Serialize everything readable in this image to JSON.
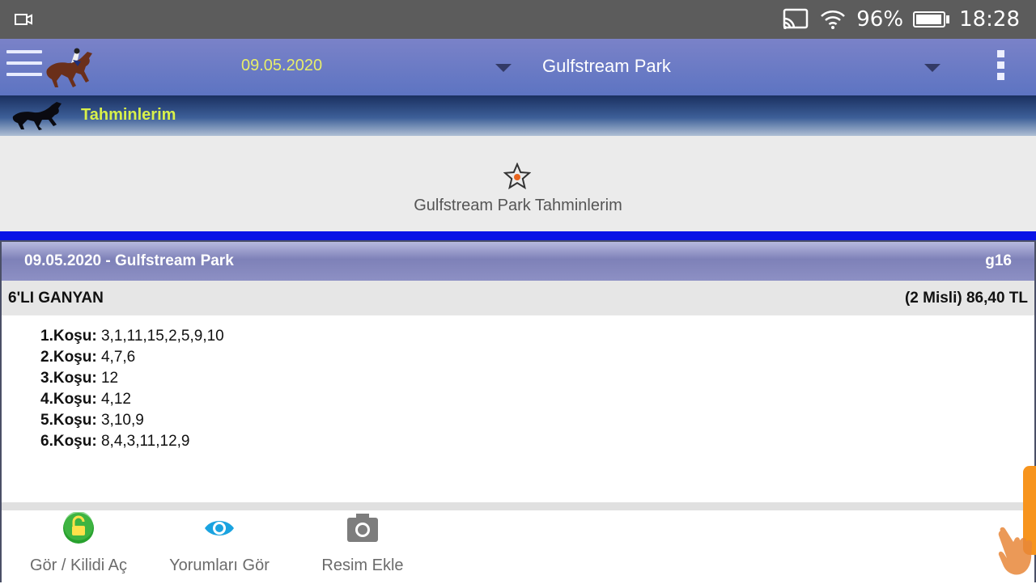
{
  "status_bar": {
    "battery_percent": "96%",
    "time": "18:28",
    "battery_level": 0.96,
    "icons": [
      "video-camera-icon",
      "cast-icon",
      "wifi-icon",
      "battery-icon"
    ]
  },
  "app_bar": {
    "date": "09.05.2020",
    "track": "Gulfstream Park",
    "icons": [
      "menu-icon",
      "horse-logo",
      "dropdown-icon",
      "overflow-menu-icon"
    ]
  },
  "section": {
    "title": "Tahminlerim"
  },
  "favorites": {
    "label": "Gulfstream Park Tahminlerim",
    "icon": "star-icon"
  },
  "card": {
    "title": "09.05.2020 - Gulfstream Park",
    "code": "g16",
    "bet_type": "6'LI GANYAN",
    "bet_amount": "(2 Misli) 86,40 TL",
    "races": [
      {
        "label": "1.Koşu:",
        "value": "3,1,11,15,2,5,9,10"
      },
      {
        "label": "2.Koşu:",
        "value": "4,7,6"
      },
      {
        "label": "3.Koşu:",
        "value": "12"
      },
      {
        "label": "4.Koşu:",
        "value": "4,12"
      },
      {
        "label": "5.Koşu:",
        "value": "3,10,9"
      },
      {
        "label": "6.Koşu:",
        "value": "8,4,3,11,12,9"
      }
    ],
    "actions": [
      {
        "label": "Gör / Kilidi Aç",
        "icon": "unlock-icon"
      },
      {
        "label": "Yorumları Gör",
        "icon": "eye-icon"
      },
      {
        "label": "Resim Ekle",
        "icon": "camera-icon"
      }
    ]
  },
  "colors": {
    "status_bar": "#5c5c5c",
    "app_bar": "#6a7bc4",
    "date_text": "#e8ee6a",
    "section_title": "#d8f04a",
    "divider": "#0a14e6",
    "side_tab": "#f7941d"
  }
}
